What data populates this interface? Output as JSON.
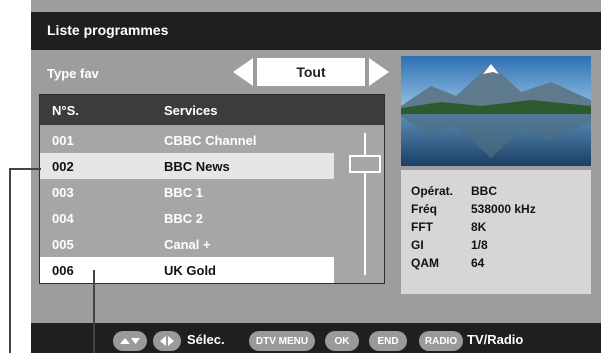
{
  "window": {
    "title": "Liste programmes"
  },
  "fav": {
    "label": "Type fav",
    "value": "Tout"
  },
  "list": {
    "headers": [
      "N°S.",
      "Services"
    ],
    "rows": [
      {
        "num": "001",
        "service": "CBBC Channel"
      },
      {
        "num": "002",
        "service": "BBC News"
      },
      {
        "num": "003",
        "service": "BBC 1"
      },
      {
        "num": "004",
        "service": "BBC 2"
      },
      {
        "num": "005",
        "service": "Canal +"
      },
      {
        "num": "006",
        "service": "UK Gold"
      }
    ],
    "highlighted_row": "002",
    "selected_row": "006"
  },
  "info": {
    "rows": [
      {
        "label": "Opérat.",
        "value": "BBC"
      },
      {
        "label": "Fréq",
        "value": "538000 kHz"
      },
      {
        "label": "FFT",
        "value": "8K"
      },
      {
        "label": "GI",
        "value": "1/8"
      },
      {
        "label": "QAM",
        "value": "64"
      }
    ]
  },
  "footer": {
    "select_label": "Sélec.",
    "dtv_menu": "DTV MENU",
    "ok": "OK",
    "end": "END",
    "radio": "RADIO",
    "tv_radio_label": "TV/Radio"
  },
  "colors": {
    "title_bar": "#1f1f1f",
    "panel": "#9d9d9d",
    "highlight": "#e6e6e6",
    "selected": "#ffffff"
  },
  "icons": {
    "up_down": "up-down-icon",
    "left_right": "left-right-icon"
  }
}
